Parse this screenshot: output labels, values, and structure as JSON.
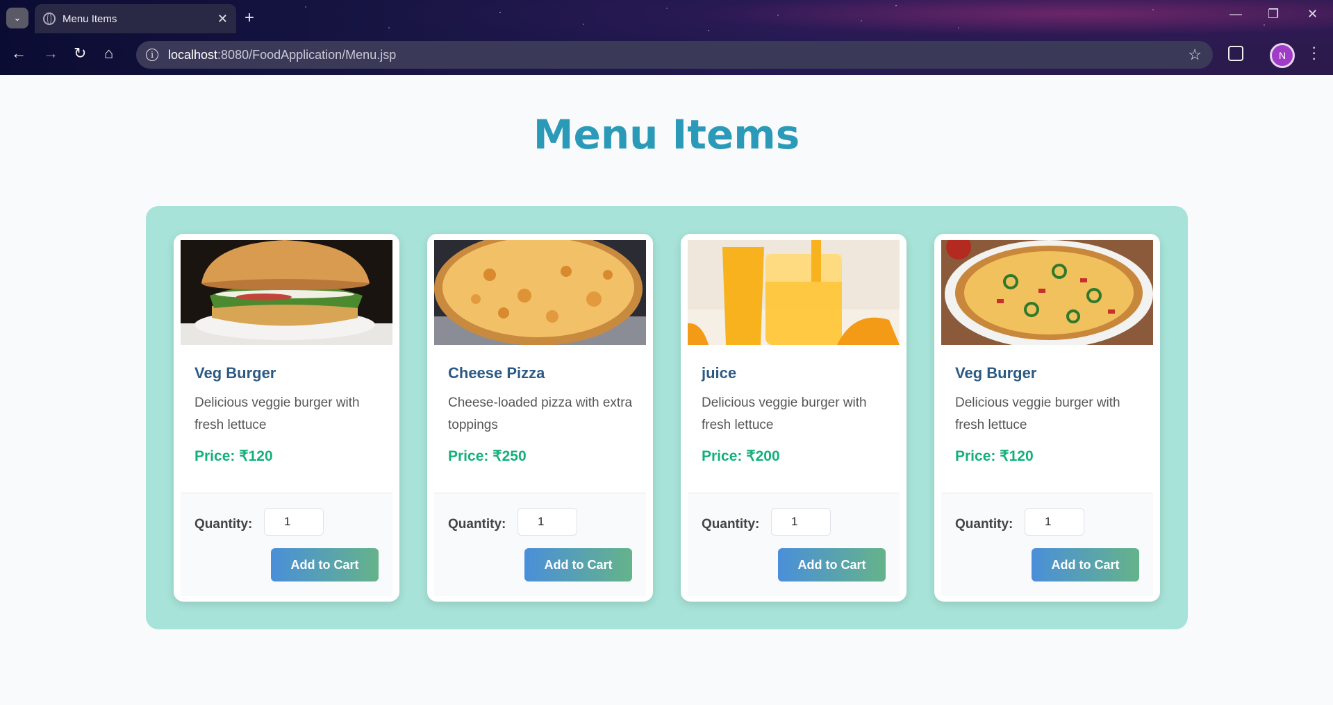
{
  "browser": {
    "tab_title": "Menu Items",
    "url_host": "localhost",
    "url_path": ":8080/FoodApplication/Menu.jsp",
    "profile_initial": "N"
  },
  "page": {
    "title": "Menu Items"
  },
  "quantity_label": "Quantity:",
  "add_label": "Add to Cart",
  "items": [
    {
      "name": "Veg Burger",
      "description": "Delicious veggie burger with fresh lettuce",
      "price_label": "Price:",
      "price": "₹120",
      "quantity": "1",
      "image": "veg-burger-photo"
    },
    {
      "name": "Cheese Pizza",
      "description": "Cheese-loaded pizza with extra toppings",
      "price_label": "Price:",
      "price": "₹250",
      "quantity": "1",
      "image": "cheese-pizza-photo"
    },
    {
      "name": "juice",
      "description": "Delicious veggie burger with fresh lettuce",
      "price_label": "Price:",
      "price": "₹200",
      "quantity": "1",
      "image": "orange-juice-photo"
    },
    {
      "name": "Veg Burger",
      "description": "Delicious veggie burger with fresh lettuce",
      "price_label": "Price:",
      "price": "₹120",
      "quantity": "1",
      "image": "veggie-pizza-photo"
    }
  ],
  "colors": {
    "title": "#2b9ab8",
    "container": "#a7e3d8",
    "item_name": "#2d5a84",
    "price": "#14b07a",
    "button_start": "#4a8fd9",
    "button_end": "#65b38a"
  }
}
